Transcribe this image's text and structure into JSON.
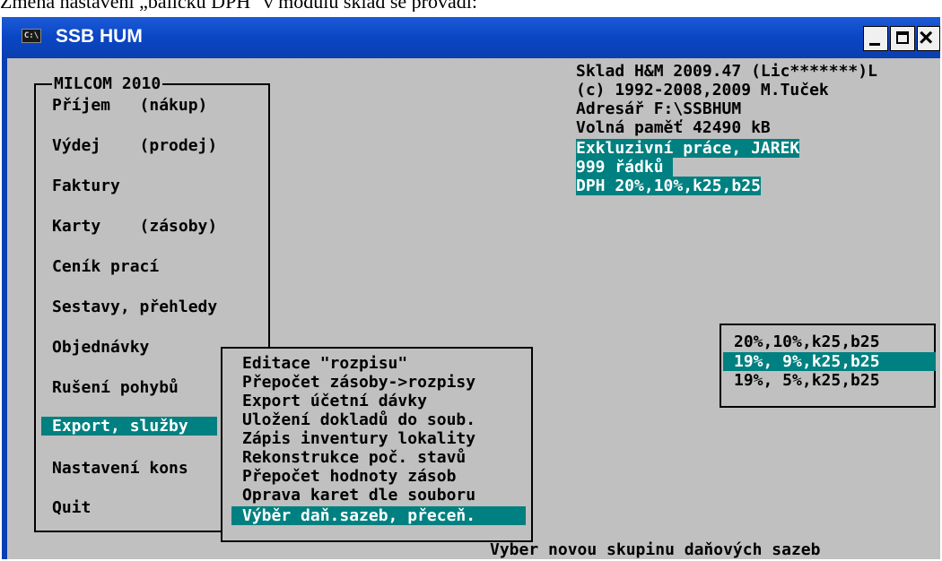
{
  "document": {
    "caption_line": "Změna nastavení „balíčku DPH\" v modulu sklad se provádí:"
  },
  "window": {
    "title": "SSB HUM",
    "icon_label": "C:\\",
    "buttons": {
      "minimize": "minimize",
      "maximize": "maximize",
      "close": "close"
    }
  },
  "menu": {
    "title": "MILCOM 2010",
    "selected_index": 8,
    "items": [
      {
        "label": "Příjem   (nákup)"
      },
      {
        "label": "Výdej    (prodej)"
      },
      {
        "label": "Faktury"
      },
      {
        "label": "Karty    (zásoby)"
      },
      {
        "label": "Ceník prací"
      },
      {
        "label": "Sestavy, přehledy"
      },
      {
        "label": "Objednávky"
      },
      {
        "label": "Rušení pohybů"
      },
      {
        "label": "Export, služby"
      },
      {
        "label": "Nastavení kons"
      },
      {
        "label": "Quit"
      }
    ]
  },
  "info": {
    "line1": "Sklad H&M 2009.47 (Lic*******)L",
    "line2": "(c) 1992-2008,2009 M.Tuček",
    "line3": "Adresář F:\\SSBHUM",
    "line4": "Volná paměť 42490 kB",
    "highlight1": "Exkluzivní práce, JAREK",
    "highlight2": "999 řádků ",
    "highlight3": "DPH 20%,10%,k25,b25"
  },
  "submenu": {
    "selected_index": 8,
    "items": [
      {
        "label": "Editace \"rozpisu\""
      },
      {
        "label": "Přepočet zásoby->rozpisy"
      },
      {
        "label": "Export účetní dávky"
      },
      {
        "label": "Uložení dokladů do soub."
      },
      {
        "label": "Zápis inventury lokality"
      },
      {
        "label": "Rekonstrukce poč. stavů"
      },
      {
        "label": "Přepočet hodnoty zásob"
      },
      {
        "label": "Oprava karet dle souboru"
      },
      {
        "label": "Výběr daň.sazeb, přeceň."
      }
    ]
  },
  "tax_options": {
    "selected_index": 1,
    "items": [
      {
        "label": "20%,10%,k25,b25"
      },
      {
        "label": "19%, 9%,k25,b25"
      },
      {
        "label": "19%, 5%,k25,b25"
      }
    ]
  },
  "status": {
    "text": "Vyber novou skupinu daňových sazeb"
  }
}
